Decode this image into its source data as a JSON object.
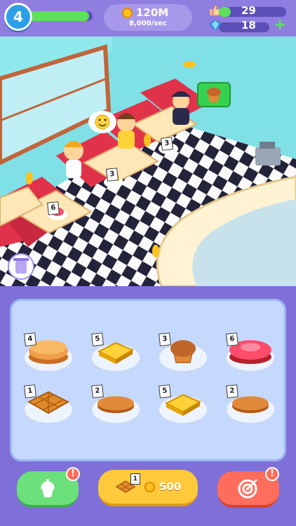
{
  "hud": {
    "level": "4",
    "xp_progress": 0.95,
    "coins": "120M",
    "coin_rate": "8,000/sec",
    "likes": "29",
    "likes_progress": 0.18,
    "gems": "18",
    "plus_label": "+"
  },
  "scene": {
    "order_icon": "muffin-icon",
    "tags": [
      "6",
      "3",
      "3"
    ]
  },
  "menu": {
    "items": [
      {
        "name": "pancakes",
        "price": "4",
        "icon": "pancake-stack-icon"
      },
      {
        "name": "toast",
        "price": "5",
        "icon": "toast-icon"
      },
      {
        "name": "muffin",
        "price": "3",
        "icon": "muffin-icon"
      },
      {
        "name": "jelly-cake",
        "price": "6",
        "icon": "jelly-cake-icon"
      },
      {
        "name": "waffle",
        "price": "1",
        "icon": "waffle-icon"
      },
      {
        "name": "pancake",
        "price": "2",
        "icon": "pancake-icon"
      },
      {
        "name": "toast-2",
        "price": "5",
        "icon": "toast-icon"
      },
      {
        "name": "pancake-2",
        "price": "2",
        "icon": "pancake-icon"
      }
    ]
  },
  "footer": {
    "upgrade_price": "1",
    "upgrade_cost": "500",
    "left_alert": "!",
    "right_alert": "!"
  },
  "colors": {
    "hud": "#8f7ddf",
    "panel": "#7e70d8",
    "tray": "#c5d9ff",
    "green": "#6ce07a",
    "yellow": "#ffc93c",
    "red": "#ff6d5c"
  }
}
